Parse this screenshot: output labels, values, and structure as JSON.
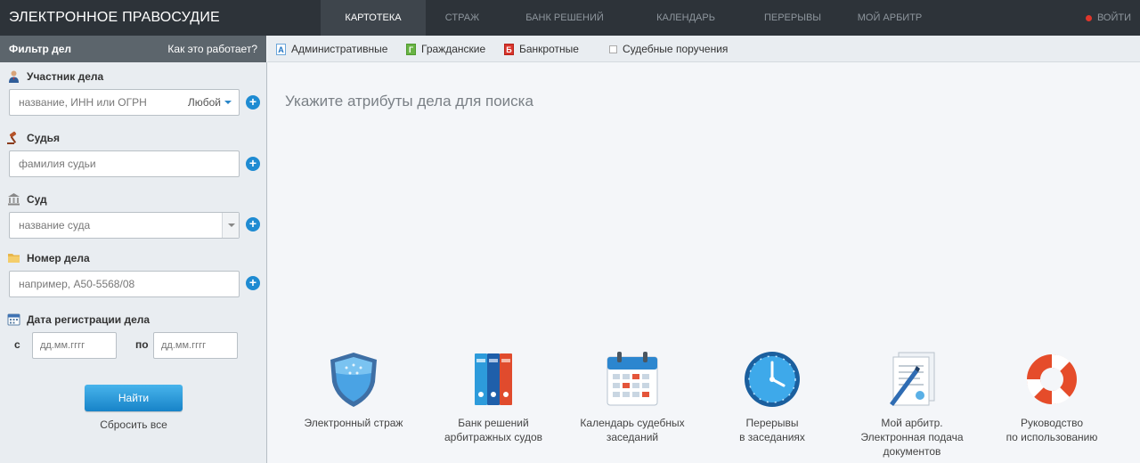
{
  "header": {
    "brand": "ЭЛЕКТРОННОЕ ПРАВОСУДИЕ",
    "nav": [
      {
        "label": "КАРТОТЕКА",
        "active": true
      },
      {
        "label": "СТРАЖ",
        "active": false
      },
      {
        "label": "БАНК РЕШЕНИЙ",
        "active": false
      },
      {
        "label": "КАЛЕНДАРЬ",
        "active": false
      },
      {
        "label": "ПЕРЕРЫВЫ",
        "active": false
      },
      {
        "label": "МОЙ АРБИТР",
        "active": false
      }
    ],
    "logout": "ВОЙТИ"
  },
  "filter_bar": {
    "title": "Фильтр дел",
    "help_link": "Как это работает?"
  },
  "categories": [
    {
      "label": "Административные",
      "icon": "А",
      "icon_name": "admin-icon"
    },
    {
      "label": "Гражданские",
      "icon": "Г",
      "icon_name": "civil-icon"
    },
    {
      "label": "Банкротные",
      "icon": "Б",
      "icon_name": "bankruptcy-icon"
    },
    {
      "label": "Судебные поручения",
      "icon_name": "checkbox"
    }
  ],
  "sidebar": {
    "participant": {
      "label": "Участник дела",
      "placeholder": "название, ИНН или ОГРН",
      "role": "Любой"
    },
    "judge": {
      "label": "Судья",
      "placeholder": "фамилия судьи"
    },
    "court": {
      "label": "Суд",
      "placeholder": "название суда"
    },
    "case_number": {
      "label": "Номер дела",
      "placeholder": "например, А50-5568/08"
    },
    "date": {
      "label": "Дата регистрации дела",
      "from_label": "с",
      "to_label": "по",
      "from_placeholder": "дд.мм.гггг",
      "to_placeholder": "дд.мм.гггг"
    },
    "search_button": "Найти",
    "reset_link": "Сбросить все"
  },
  "main": {
    "hint": "Укажите атрибуты дела для поиска",
    "tiles": [
      {
        "label": "Электронный страж",
        "icon": "shield-icon"
      },
      {
        "label": "Банк решений\nарбитражных судов",
        "icon": "binders-icon"
      },
      {
        "label": "Календарь судебных\nзаседаний",
        "icon": "calendar-icon"
      },
      {
        "label": "Перерывы\nв заседаниях",
        "icon": "clock-icon"
      },
      {
        "label": "Мой арбитр.\nЭлектронная подача\nдокументов",
        "icon": "document-pen-icon"
      },
      {
        "label": "Руководство\nпо использованию",
        "icon": "lifebuoy-icon"
      }
    ]
  },
  "colors": {
    "topbar": "#2d3339",
    "accent": "#1e8bd2",
    "logout_dot": "#e0362b"
  }
}
